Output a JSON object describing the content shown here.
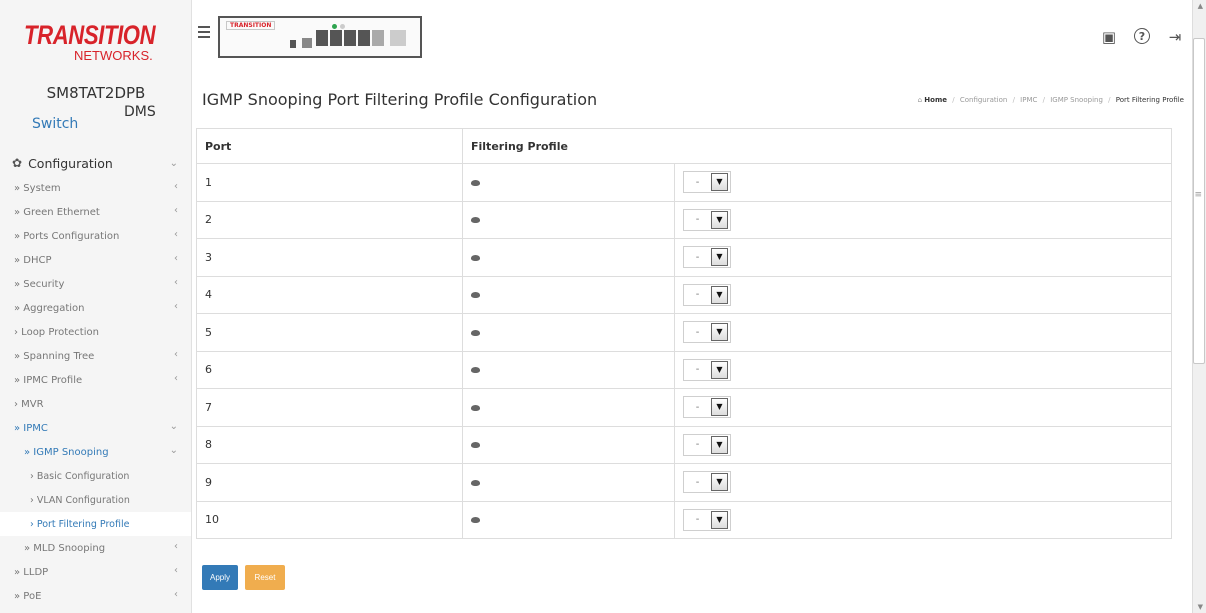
{
  "logo": {
    "top": "TRANSITION",
    "bottom": "NETWORKS."
  },
  "device": {
    "name": "SM8TAT2DPB",
    "brand": "TRANSITION"
  },
  "mode_tabs": {
    "switch": "Switch",
    "dms": "DMS"
  },
  "menu": {
    "section": "Configuration",
    "items": [
      {
        "label": "» System",
        "caret": "‹"
      },
      {
        "label": "» Green Ethernet",
        "caret": "‹"
      },
      {
        "label": "» Ports Configuration",
        "caret": "‹"
      },
      {
        "label": "» DHCP",
        "caret": "‹"
      },
      {
        "label": "» Security",
        "caret": "‹"
      },
      {
        "label": "» Aggregation",
        "caret": "‹"
      },
      {
        "label": "› Loop Protection",
        "caret": ""
      },
      {
        "label": "» Spanning Tree",
        "caret": "‹"
      },
      {
        "label": "» IPMC Profile",
        "caret": "‹"
      },
      {
        "label": "› MVR",
        "caret": ""
      },
      {
        "label": "» IPMC",
        "caret": "⌄"
      },
      {
        "label": "» IGMP Snooping",
        "caret": "⌄"
      },
      {
        "label": "› Basic Configuration",
        "caret": ""
      },
      {
        "label": "› VLAN Configuration",
        "caret": ""
      },
      {
        "label": "› Port Filtering Profile",
        "caret": ""
      },
      {
        "label": "» MLD Snooping",
        "caret": "‹"
      },
      {
        "label": "» LLDP",
        "caret": "‹"
      },
      {
        "label": "» PoE",
        "caret": "‹"
      }
    ]
  },
  "header": {
    "title": "IGMP Snooping Port Filtering Profile Configuration",
    "breadcrumb": [
      "Home",
      "Configuration",
      "IPMC",
      "IGMP Snooping",
      "Port Filtering Profile"
    ]
  },
  "table": {
    "headers": [
      "Port",
      "Filtering Profile"
    ],
    "rows": [
      {
        "port": "1",
        "profile": "-"
      },
      {
        "port": "2",
        "profile": "-"
      },
      {
        "port": "3",
        "profile": "-"
      },
      {
        "port": "4",
        "profile": "-"
      },
      {
        "port": "5",
        "profile": "-"
      },
      {
        "port": "6",
        "profile": "-"
      },
      {
        "port": "7",
        "profile": "-"
      },
      {
        "port": "8",
        "profile": "-"
      },
      {
        "port": "9",
        "profile": "-"
      },
      {
        "port": "10",
        "profile": "-"
      }
    ]
  },
  "buttons": {
    "apply": "Apply",
    "reset": "Reset"
  },
  "colors": {
    "accent": "#337ab7",
    "reset": "#f0ad4e",
    "brand": "#d8232a"
  }
}
